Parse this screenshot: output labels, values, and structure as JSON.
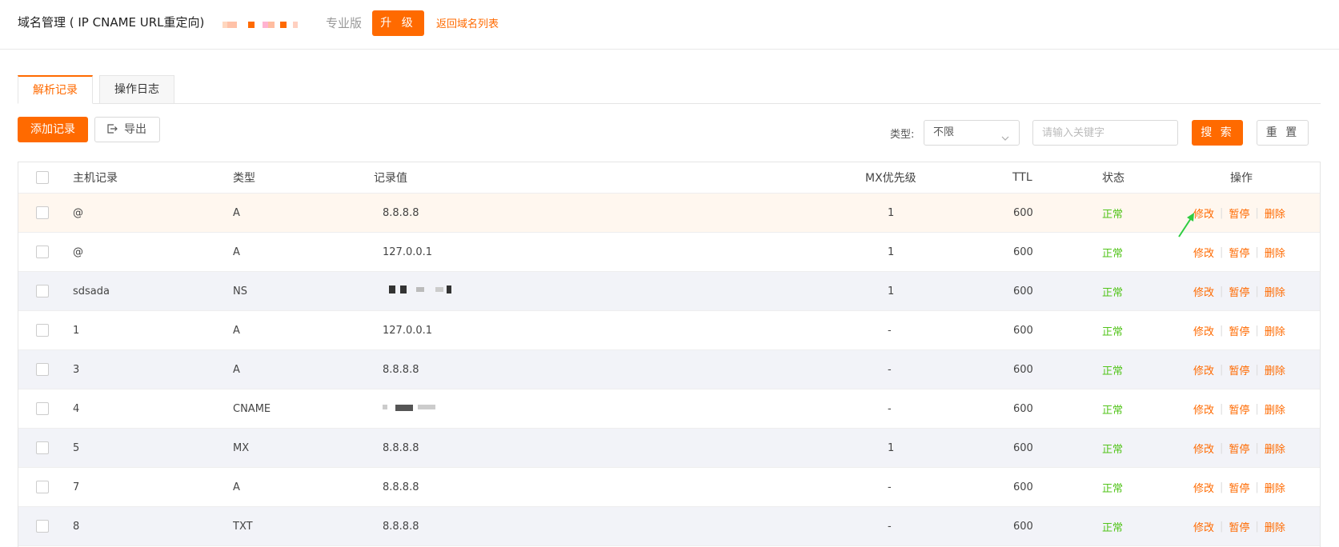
{
  "header": {
    "title": "域名管理 ( IP CNAME URL重定向)",
    "edition": "专业版",
    "upgrade_label": "升 级",
    "back_link": "返回域名列表"
  },
  "tabs": [
    {
      "label": "解析记录",
      "active": true
    },
    {
      "label": "操作日志",
      "active": false
    }
  ],
  "toolbar": {
    "add_label": "添加记录",
    "export_label": "导出",
    "type_label": "类型:",
    "type_value": "不限",
    "search_placeholder": "请输入关键字",
    "search_label": "搜 索",
    "reset_label": "重 置"
  },
  "table": {
    "columns": [
      "主机记录",
      "类型",
      "记录值",
      "MX优先级",
      "TTL",
      "状态",
      "操作"
    ],
    "actions": [
      "修改",
      "暂停",
      "删除"
    ],
    "rows": [
      {
        "host": "@",
        "type": "A",
        "value": "8.8.8.8",
        "mx": "1",
        "ttl": "600",
        "status": "正常"
      },
      {
        "host": "@",
        "type": "A",
        "value": "127.0.0.1",
        "mx": "1",
        "ttl": "600",
        "status": "正常"
      },
      {
        "host": "sdsada",
        "type": "NS",
        "value": "",
        "mx": "1",
        "ttl": "600",
        "status": "正常"
      },
      {
        "host": "1",
        "type": "A",
        "value": "127.0.0.1",
        "mx": "-",
        "ttl": "600",
        "status": "正常"
      },
      {
        "host": "3",
        "type": "A",
        "value": "8.8.8.8",
        "mx": "-",
        "ttl": "600",
        "status": "正常"
      },
      {
        "host": "4",
        "type": "CNAME",
        "value": "",
        "mx": "-",
        "ttl": "600",
        "status": "正常"
      },
      {
        "host": "5",
        "type": "MX",
        "value": "8.8.8.8",
        "mx": "1",
        "ttl": "600",
        "status": "正常"
      },
      {
        "host": "7",
        "type": "A",
        "value": "8.8.8.8",
        "mx": "-",
        "ttl": "600",
        "status": "正常"
      },
      {
        "host": "8",
        "type": "TXT",
        "value": "8.8.8.8",
        "mx": "-",
        "ttl": "600",
        "status": "正常"
      }
    ]
  },
  "colors": {
    "accent": "#ff6a00",
    "status_ok": "#52c41a",
    "hover_row": "#fff7ef",
    "alt_row": "#f2f3f8",
    "annotation_arrow": "#2ecc40"
  },
  "icons": [
    "export-icon",
    "chevron-down-icon",
    "annotation-arrow-icon"
  ]
}
